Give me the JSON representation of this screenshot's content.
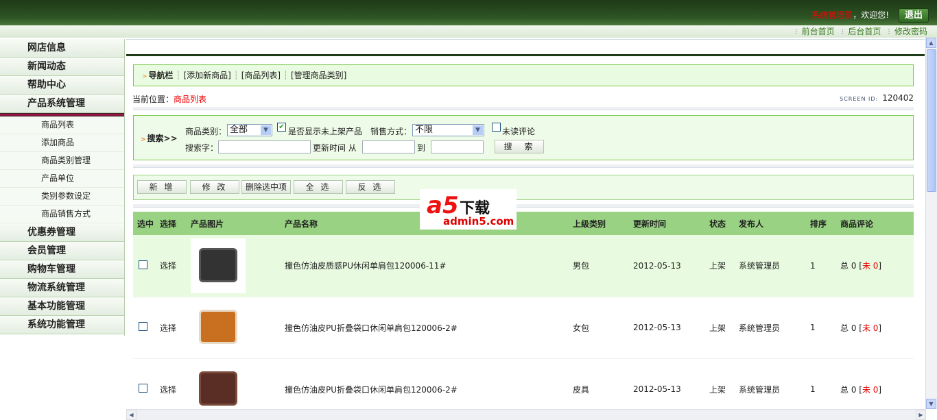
{
  "header": {
    "user": "系统管理员",
    "welcome": "，欢迎您!",
    "logout": "退出",
    "links": [
      "前台首页",
      "后台首页",
      "修改密码"
    ]
  },
  "sidebar": {
    "menus": [
      "网店信息",
      "新闻动态",
      "帮助中心",
      "产品系统管理"
    ],
    "sub": [
      "商品列表",
      "添加商品",
      "商品类别管理",
      "产品单位",
      "类别参数设定",
      "商品销售方式"
    ],
    "menus2": [
      "优惠券管理",
      "会员管理",
      "购物车管理",
      "物流系统管理",
      "基本功能管理",
      "系统功能管理"
    ]
  },
  "nav": {
    "title": "导航栏",
    "links": [
      "[添加新商品]",
      "[商品列表]",
      "[管理商品类别]"
    ]
  },
  "location": {
    "label": "当前位置：",
    "current": "商品列表"
  },
  "screen_id": {
    "label": "SCREEN ID:",
    "value": "120402"
  },
  "search": {
    "title": "搜索>>",
    "category_label": "商品类别：",
    "category_value": "全部",
    "show_offline_label": "是否显示未上架产品",
    "show_offline_checked": true,
    "sale_label": "销售方式：",
    "sale_value": "不限",
    "unread_label": "未读评论",
    "unread_checked": false,
    "keyword_label": "搜索字：",
    "time_label": "更新时间 从",
    "to_label": "到",
    "button": "搜　索"
  },
  "toolbar": [
    "新 增",
    "修 改",
    "删除选中项",
    "全 选",
    "反 选"
  ],
  "watermark": {
    "big": "a5",
    "cn": "下载",
    "domain": "admin5.com"
  },
  "table": {
    "headers": [
      "选中",
      "选择",
      "产品图片",
      "产品名称",
      "上级类别",
      "更新时间",
      "状态",
      "发布人",
      "排序",
      "商品评论"
    ],
    "rows": [
      {
        "select": "选择",
        "name": "撞色仿油皮质感PU休闲单肩包120006-11#",
        "category": "男包",
        "time": "2012-05-13",
        "status": "上架",
        "publisher": "系统管理员",
        "sort": "1",
        "review_total": "总 0 [",
        "review_unread": "未 0",
        "review_end": "]"
      },
      {
        "select": "选择",
        "name": "撞色仿油皮PU折叠袋口休闲单肩包120006-2#",
        "category": "女包",
        "time": "2012-05-13",
        "status": "上架",
        "publisher": "系统管理员",
        "sort": "1",
        "review_total": "总 0 [",
        "review_unread": "未 0",
        "review_end": "]"
      },
      {
        "select": "选择",
        "name": "撞色仿油皮PU折叠袋口休闲单肩包120006-2#",
        "category": "皮具",
        "time": "2012-05-13",
        "status": "上架",
        "publisher": "系统管理员",
        "sort": "1",
        "review_total": "总 0 [",
        "review_unread": "未 0",
        "review_end": "]"
      }
    ]
  }
}
